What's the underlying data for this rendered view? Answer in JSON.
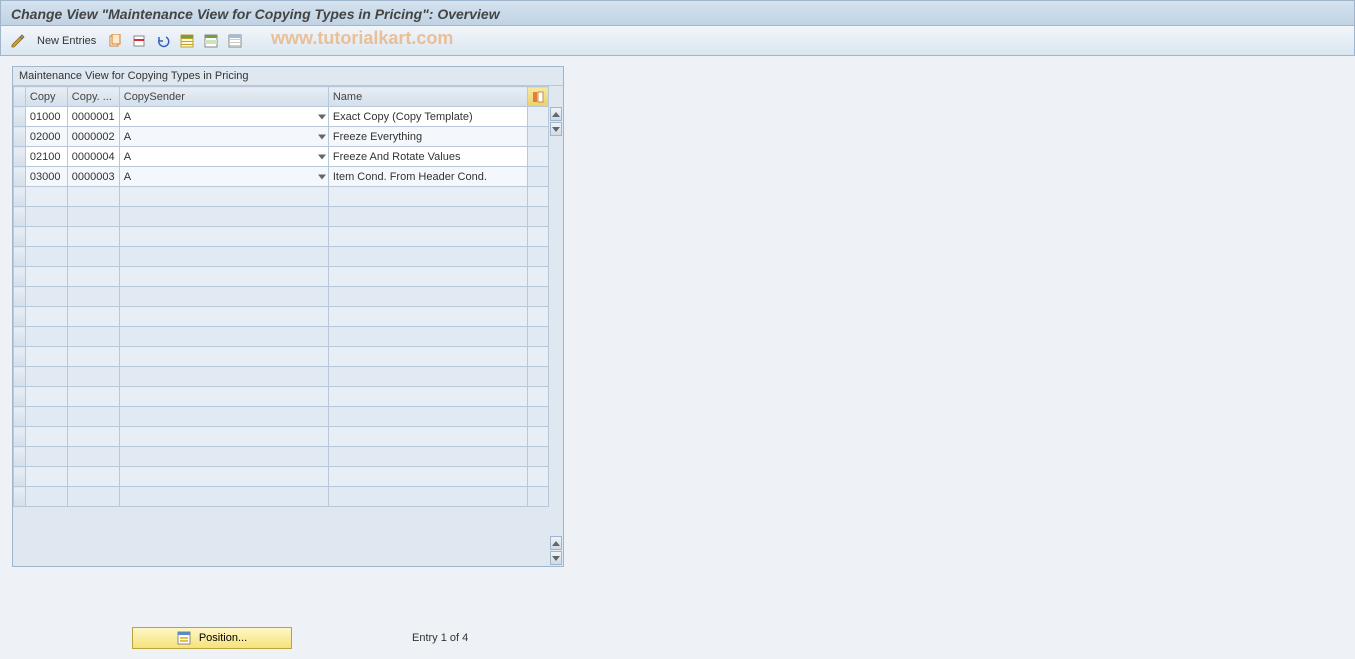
{
  "title": "Change View \"Maintenance View for Copying Types in Pricing\": Overview",
  "toolbar": {
    "new_entries_label": "New Entries"
  },
  "watermark": "www.tutorialkart.com",
  "table": {
    "title": "Maintenance View for Copying Types in Pricing",
    "columns": {
      "copy": "Copy",
      "copy2": "Copy. ...",
      "sender": "CopySender",
      "name": "Name"
    },
    "rows": [
      {
        "copy": "01000",
        "copy2": "0000001",
        "sender": "A",
        "name": "Exact Copy (Copy Template)"
      },
      {
        "copy": "02000",
        "copy2": "0000002",
        "sender": "A",
        "name": "Freeze Everything"
      },
      {
        "copy": "02100",
        "copy2": "0000004",
        "sender": "A",
        "name": "Freeze And Rotate Values"
      },
      {
        "copy": "03000",
        "copy2": "0000003",
        "sender": "A",
        "name": "Item Cond. From Header Cond."
      }
    ]
  },
  "footer": {
    "position_label": "Position...",
    "entry_text": "Entry 1 of 4"
  }
}
